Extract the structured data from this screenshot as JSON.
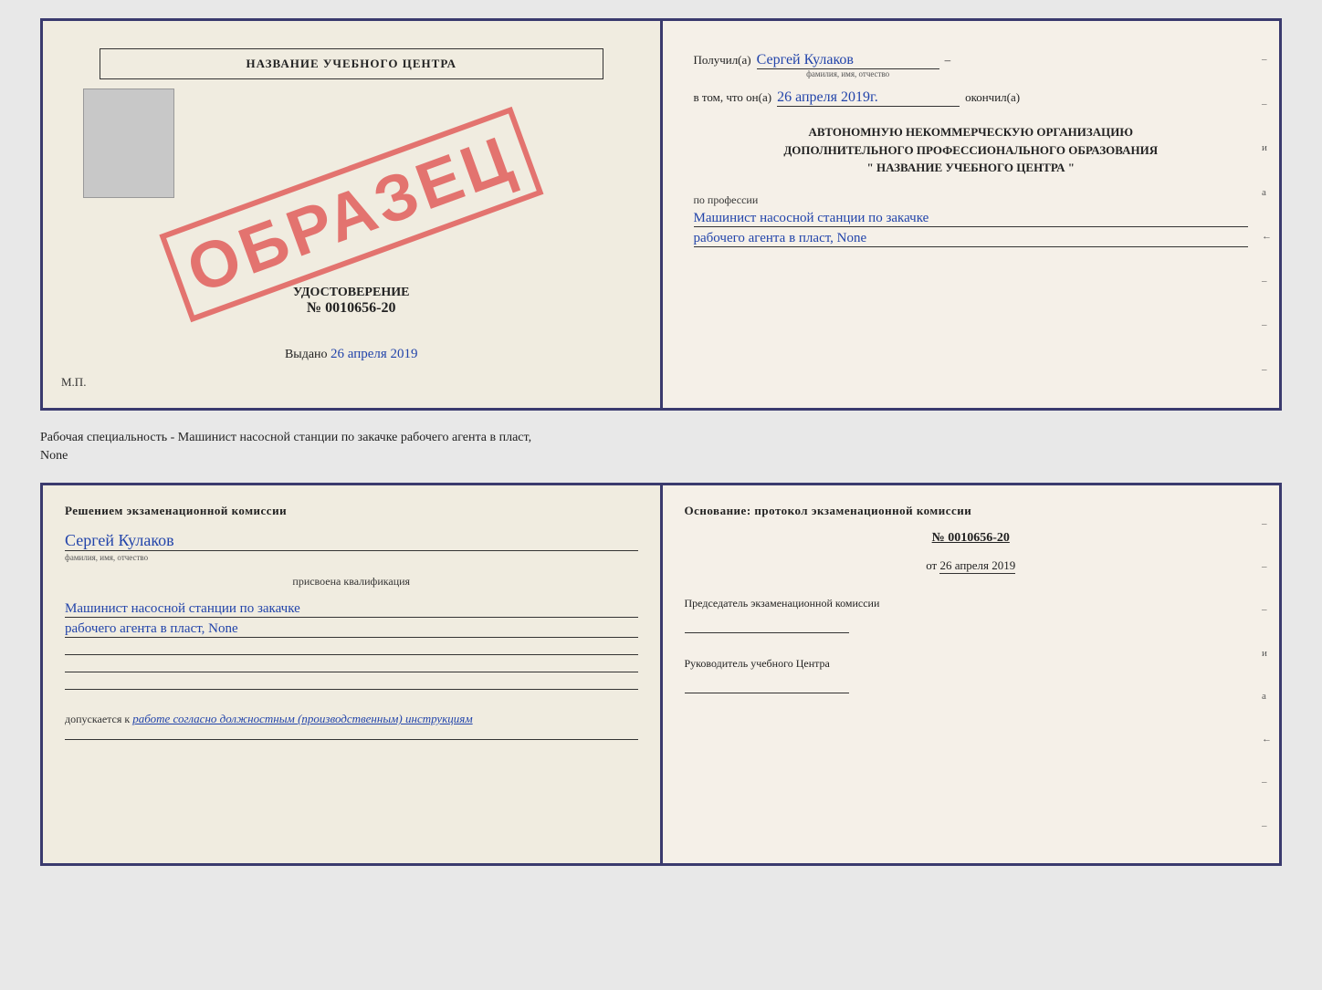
{
  "page": {
    "bg_color": "#e8e8e8"
  },
  "top_doc": {
    "left": {
      "school_name": "НАЗВАНИЕ УЧЕБНОГО ЦЕНТРА",
      "obrazec": "ОБРАЗЕЦ",
      "udostoverenie_label": "УДОСТОВЕРЕНИЕ",
      "number": "№ 0010656-20",
      "vydano_label": "Выдано",
      "vydano_date": "26 апреля 2019",
      "mp_label": "М.П."
    },
    "right": {
      "poluchil_label": "Получил(а)",
      "poluchil_name": "Сергей Кулаков",
      "familiya_hint": "фамилия, имя, отчество",
      "dash": "–",
      "vtom_label": "в том, что он(а)",
      "vtom_date": "26 апреля 2019г.",
      "okonchil_label": "окончил(а)",
      "center_text_line1": "АВТОНОМНУЮ НЕКОММЕРЧЕСКУЮ ОРГАНИЗАЦИЮ",
      "center_text_line2": "ДОПОЛНИТЕЛЬНОГО ПРОФЕССИОНАЛЬНОГО ОБРАЗОВАНИЯ",
      "center_text_line3": "\"   НАЗВАНИЕ УЧЕБНОГО ЦЕНТРА   \"",
      "po_professii_label": "по профессии",
      "profession_line1": "Машинист насосной станции по закачке",
      "profession_line2": "рабочего агента в пласт, None",
      "right_dashes": [
        "-",
        "-",
        "-",
        "–",
        "и",
        "а",
        "←",
        "-",
        "-",
        "-"
      ]
    }
  },
  "between": {
    "text": "Рабочая специальность - Машинист насосной станции по закачке рабочего агента в пласт,",
    "text2": "None"
  },
  "bottom_doc": {
    "left": {
      "komissia_title": "Решением экзаменационной комиссии",
      "name_hw": "Сергей Кулаков",
      "name_hint": "фамилия, имя, отчество",
      "prisvoena_label": "присвоена квалификация",
      "kvalif_line1": "Машинист насосной станции по закачке",
      "kvalif_line2": "рабочего агента в пласт, None",
      "dopuskaetsya_label": "допускается к",
      "dopusk_hw": "работе согласно должностным (производственным) инструкциям"
    },
    "right": {
      "osnov_title": "Основание: протокол экзаменационной комиссии",
      "protocol_number": "№ 0010656-20",
      "ot_label": "от",
      "ot_date": "26 апреля 2019",
      "predsedatel_label": "Председатель экзаменационной комиссии",
      "rukovoditel_label": "Руководитель учебного Центра",
      "right_dashes": [
        "-",
        "-",
        "-",
        "–",
        "и",
        "а",
        "←",
        "-",
        "-",
        "-"
      ]
    }
  }
}
